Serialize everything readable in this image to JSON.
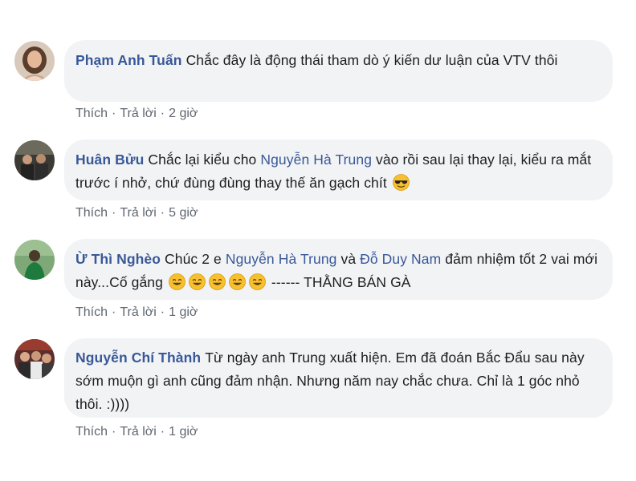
{
  "comments": [
    {
      "author": "Phạm Anh Tuấn",
      "text": "Chắc đây là động thái tham dò ý kiến dư luận của VTV thôi",
      "like": "Thích",
      "reply": "Trả lời",
      "time": "2 giờ",
      "avatar_icon": "user-avatar-woman"
    },
    {
      "author": "Huân Bửu",
      "text_before": "Chắc lại kiểu cho ",
      "mention": "Nguyễn Hà Trung",
      "text_after": " vào rồi sau lại thay lại, kiểu ra mắt trước í nhở, chứ đùng đùng thay thế ăn gạch chít",
      "emoji": "sunglasses-emoji",
      "like": "Thích",
      "reply": "Trả lời",
      "time": "5 giờ",
      "avatar_icon": "user-avatar-group"
    },
    {
      "author": "Ừ Thì Nghèo",
      "text_before": "Chúc 2 e ",
      "mention_1": "Nguyễn Hà Trung",
      "text_middle": " và ",
      "mention_2": "Đỗ Duy Nam",
      "text_after": " đảm nhiệm tốt 2 vai mới này...Cố gắng",
      "emoji": "smile-emoji",
      "emoji_count": 5,
      "text_end": "------ THẰNG BÁN GÀ",
      "like": "Thích",
      "reply": "Trả lời",
      "time": "1 giờ",
      "avatar_icon": "user-avatar-green"
    },
    {
      "author": "Nguyễn Chí Thành",
      "text": "Từ ngày anh Trung xuất hiện. Em đã đoán Bắc Đẩu sau này sớm muộn gì anh cũng đảm nhận. Nhưng năm nay chắc chưa. Chỉ là 1 góc nhỏ thôi. :))))",
      "like": "Thích",
      "reply": "Trả lời",
      "time": "1 giờ",
      "avatar_icon": "user-avatar-crowd"
    }
  ],
  "colors": {
    "author": "#385898",
    "bubble": "#f2f3f5",
    "meta": "#606770",
    "text": "#1c1e21"
  }
}
